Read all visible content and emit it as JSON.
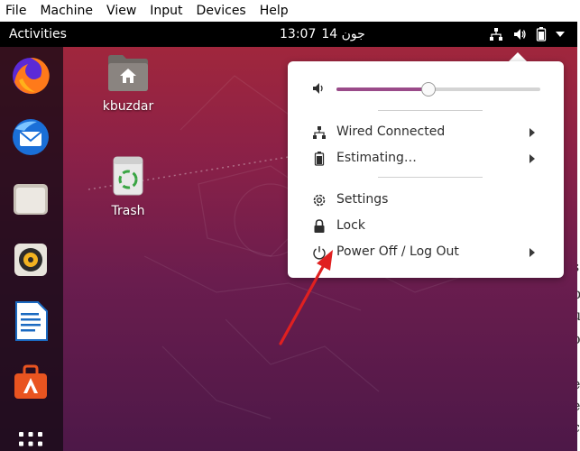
{
  "host_menu": [
    "File",
    "Machine",
    "View",
    "Input",
    "Devices",
    "Help"
  ],
  "topbar": {
    "activities": "Activities",
    "time": "13:07",
    "date": "14 جون",
    "tray_icons": [
      "network-icon",
      "volume-icon",
      "battery-icon",
      "dropdown-icon"
    ]
  },
  "dock": {
    "items": [
      "firefox",
      "thunderbird",
      "files",
      "rhythmbox",
      "libreoffice-writer",
      "ubuntu-software",
      "show-applications"
    ]
  },
  "desktop": {
    "icons": [
      {
        "label": "kbuzdar",
        "icon": "home-folder-icon"
      },
      {
        "label": "Trash",
        "icon": "trash-icon"
      }
    ]
  },
  "system_menu": {
    "volume_level": 0.45,
    "items": [
      {
        "label": "Wired Connected",
        "icon": "network-icon",
        "submenu": true
      },
      {
        "label": "Estimating…",
        "icon": "battery-icon",
        "submenu": true
      },
      {
        "label": "Settings",
        "icon": "settings-icon",
        "submenu": false
      },
      {
        "label": "Lock",
        "icon": "lock-icon",
        "submenu": false
      },
      {
        "label": "Power Off / Log Out",
        "icon": "power-icon",
        "submenu": true
      }
    ]
  },
  "colors": {
    "topbar": "#000000",
    "accent": "#9a4b89",
    "annotation_arrow": "#e02020",
    "wallpaper_top": "#a5283a",
    "wallpaper_bottom": "#4d1848"
  },
  "edge_text": [
    "s",
    "p",
    "u",
    "o",
    "l",
    "e",
    "e",
    "c"
  ]
}
